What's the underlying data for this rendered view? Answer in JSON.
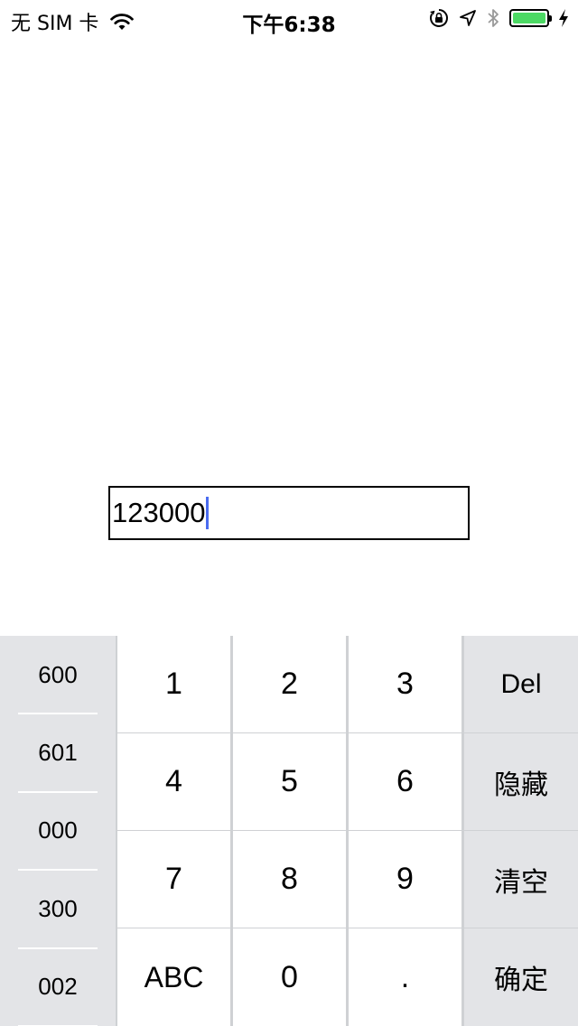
{
  "status_bar": {
    "carrier": "无 SIM 卡",
    "time": "下午6:38",
    "battery_color": "#4cd964",
    "icons": [
      "wifi-icon",
      "orientation-lock-icon",
      "location-icon",
      "bluetooth-icon",
      "battery-icon",
      "charging-bolt-icon"
    ]
  },
  "input": {
    "value": "123000",
    "caret_color": "#4a6cf0"
  },
  "keyboard": {
    "presets": [
      "600",
      "601",
      "000",
      "300",
      "002"
    ],
    "digits": [
      [
        "1",
        "2",
        "3"
      ],
      [
        "4",
        "5",
        "6"
      ],
      [
        "7",
        "8",
        "9"
      ],
      [
        "ABC",
        "0",
        "."
      ]
    ],
    "functions": [
      "Del",
      "隐藏",
      "清空",
      "确定"
    ],
    "key_color": "#ffffff",
    "function_key_color": "#e3e4e7",
    "divider_color": "#cfd1d4"
  }
}
